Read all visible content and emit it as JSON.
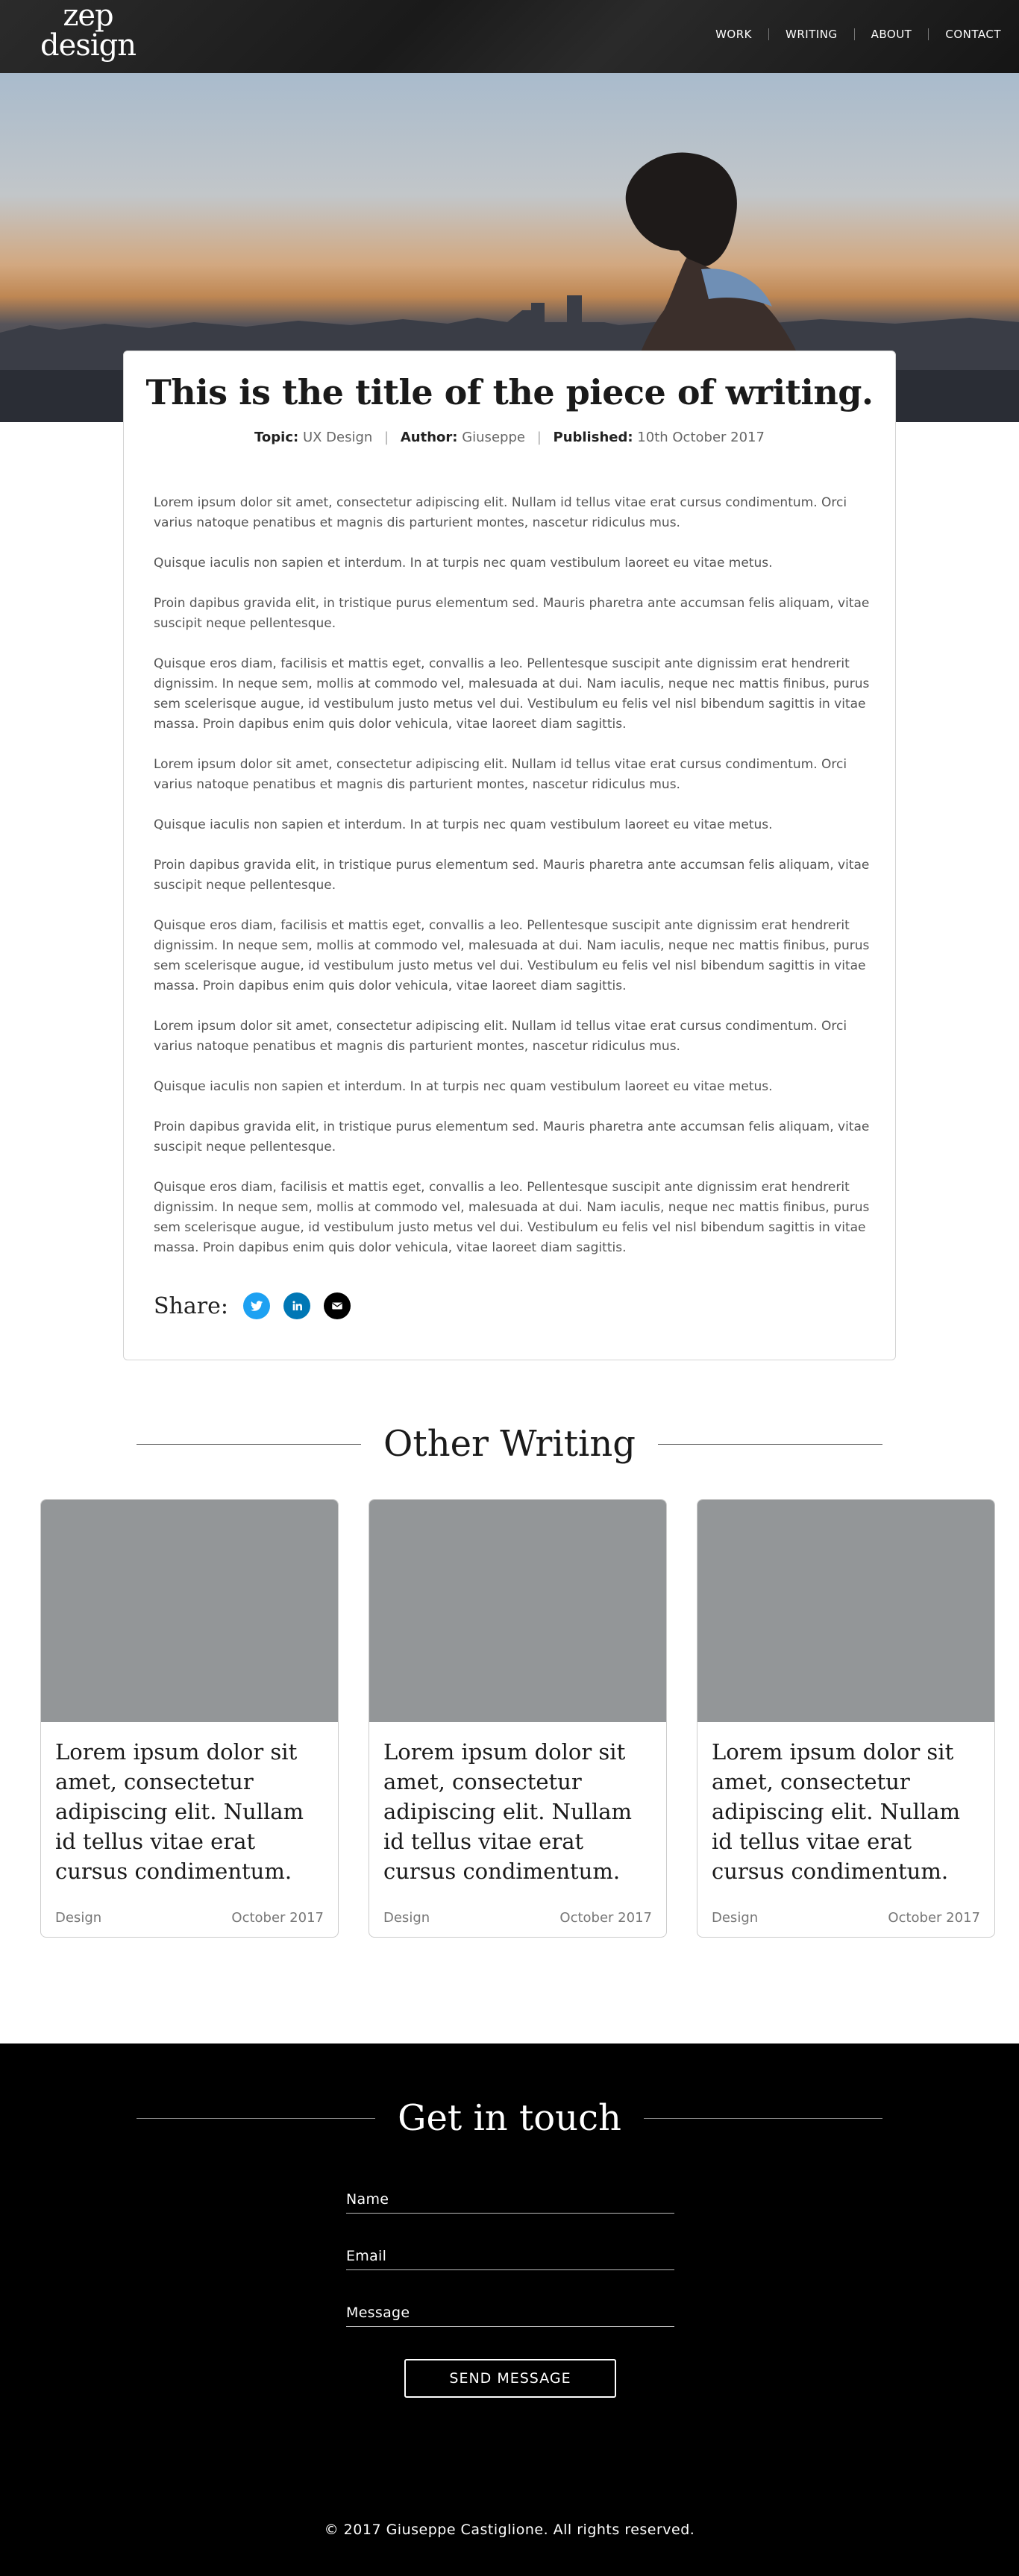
{
  "nav": {
    "logo_line1": "zep",
    "logo_line2": "design",
    "links": [
      "WORK",
      "WRITING",
      "ABOUT",
      "CONTACT"
    ]
  },
  "article": {
    "title": "This is the title of the piece of writing.",
    "meta": {
      "topic_label": "Topic:",
      "topic_value": "UX Design",
      "author_label": "Author:",
      "author_value": "Giuseppe",
      "published_label": "Published:",
      "published_value": "10th October 2017"
    },
    "paragraphs": [
      "Lorem ipsum dolor sit amet, consectetur adipiscing elit. Nullam id tellus vitae erat cursus condimentum. Orci varius natoque penatibus et magnis dis parturient montes, nascetur ridiculus mus.",
      "Quisque iaculis non sapien et interdum. In at turpis nec quam vestibulum laoreet eu vitae metus.",
      "Proin dapibus gravida elit, in tristique purus elementum sed. Mauris pharetra ante accumsan felis aliquam, vitae suscipit neque pellentesque.",
      "Quisque eros diam, facilisis et mattis eget, convallis a leo. Pellentesque suscipit ante dignissim erat hendrerit dignissim. In neque sem, mollis at commodo vel, malesuada at dui. Nam iaculis, neque nec mattis finibus, purus sem scelerisque augue, id vestibulum justo metus vel dui. Vestibulum eu felis vel nisl bibendum sagittis in vitae massa. Proin dapibus enim quis dolor vehicula, vitae laoreet diam sagittis.",
      "Lorem ipsum dolor sit amet, consectetur adipiscing elit. Nullam id tellus vitae erat cursus condimentum. Orci varius natoque penatibus et magnis dis parturient montes, nascetur ridiculus mus.",
      "Quisque iaculis non sapien et interdum. In at turpis nec quam vestibulum laoreet eu vitae metus.",
      "Proin dapibus gravida elit, in tristique purus elementum sed. Mauris pharetra ante accumsan felis aliquam, vitae suscipit neque pellentesque.",
      "Quisque eros diam, facilisis et mattis eget, convallis a leo. Pellentesque suscipit ante dignissim erat hendrerit dignissim. In neque sem, mollis at commodo vel, malesuada at dui. Nam iaculis, neque nec mattis finibus, purus sem scelerisque augue, id vestibulum justo metus vel dui. Vestibulum eu felis vel nisl bibendum sagittis in vitae massa. Proin dapibus enim quis dolor vehicula, vitae laoreet diam sagittis.",
      "Lorem ipsum dolor sit amet, consectetur adipiscing elit. Nullam id tellus vitae erat cursus condimentum. Orci varius natoque penatibus et magnis dis parturient montes, nascetur ridiculus mus.",
      "Quisque iaculis non sapien et interdum. In at turpis nec quam vestibulum laoreet eu vitae metus.",
      "Proin dapibus gravida elit, in tristique purus elementum sed. Mauris pharetra ante accumsan felis aliquam, vitae suscipit neque pellentesque.",
      "Quisque eros diam, facilisis et mattis eget, convallis a leo. Pellentesque suscipit ante dignissim erat hendrerit dignissim. In neque sem, mollis at commodo vel, malesuada at dui. Nam iaculis, neque nec mattis finibus, purus sem scelerisque augue, id vestibulum justo metus vel dui. Vestibulum eu felis vel nisl bibendum sagittis in vitae massa. Proin dapibus enim quis dolor vehicula, vitae laoreet diam sagittis."
    ],
    "share": {
      "label": "Share:",
      "icons": [
        "twitter-icon",
        "linkedin-icon",
        "email-icon"
      ],
      "colors": {
        "twitter": "#1da1f2",
        "linkedin": "#0077b5",
        "email": "#000000"
      }
    }
  },
  "other_writing": {
    "heading": "Other Writing",
    "cards": [
      {
        "title": "Lorem ipsum dolor sit amet, consectetur adipiscing elit. Nullam id tellus vitae erat cursus condimentum.",
        "category": "Design",
        "date": "October 2017"
      },
      {
        "title": "Lorem ipsum dolor sit amet, consectetur adipiscing elit. Nullam id tellus vitae erat cursus condimentum.",
        "category": "Design",
        "date": "October 2017"
      },
      {
        "title": "Lorem ipsum dolor sit amet, consectetur adipiscing elit. Nullam id tellus vitae erat cursus condimentum.",
        "category": "Design",
        "date": "October 2017"
      }
    ]
  },
  "contact": {
    "heading": "Get in touch",
    "name_label": "Name",
    "email_label": "Email",
    "message_label": "Message",
    "send_label": "SEND MESSAGE"
  },
  "footer": {
    "copyright": "© 2017 Giuseppe Castiglione. All rights reserved."
  }
}
